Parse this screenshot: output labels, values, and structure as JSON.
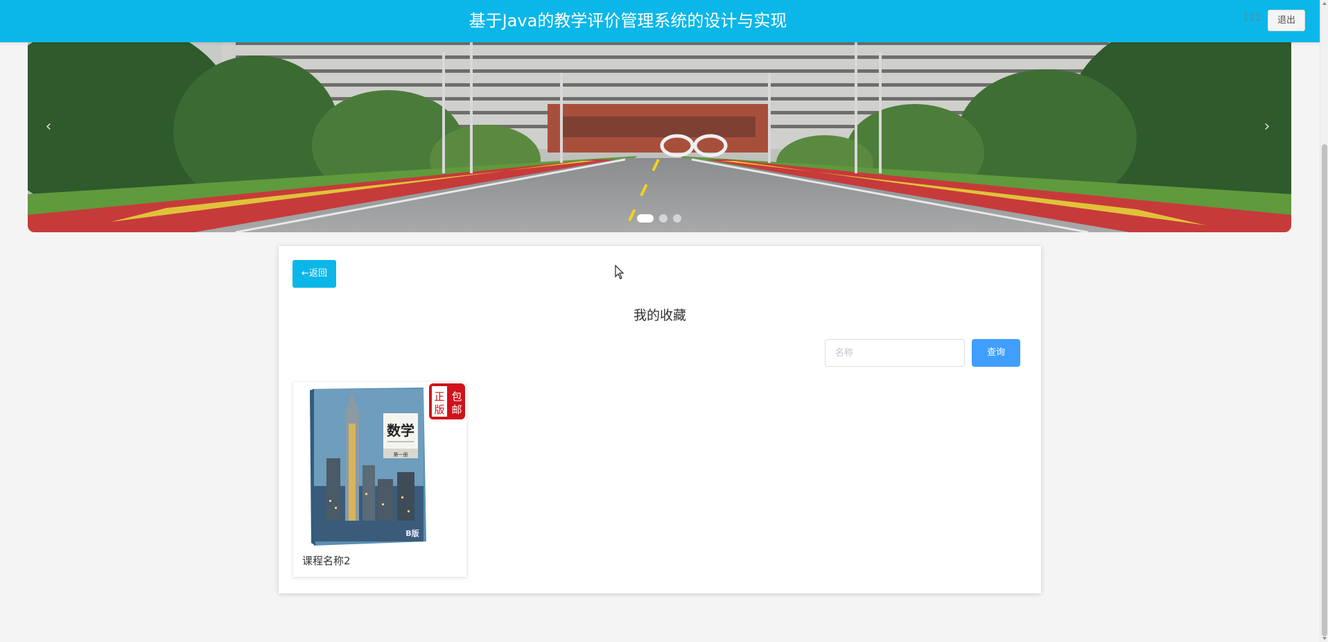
{
  "header": {
    "title": "基于Java的教学评价管理系统的设计与实现",
    "username": "111",
    "logout_label": "退出"
  },
  "carousel": {
    "prev_label": "‹",
    "next_label": "›",
    "slide_count": 3,
    "active_slide": 1
  },
  "page": {
    "back_label": "←返回",
    "title": "我的收藏",
    "search_placeholder": "名称",
    "search_value": "",
    "search_button": "查询"
  },
  "favorites": [
    {
      "name": "课程名称2",
      "cover": {
        "book_title": "数学",
        "volume": "第一册",
        "badge_left": "正版",
        "badge_right": "包邮",
        "edition_mark": "B版"
      }
    }
  ],
  "colors": {
    "header_bg": "#0bb7e8",
    "primary": "#409eff",
    "back_btn": "#0bb7e8",
    "stamp_red": "#d0121b"
  }
}
